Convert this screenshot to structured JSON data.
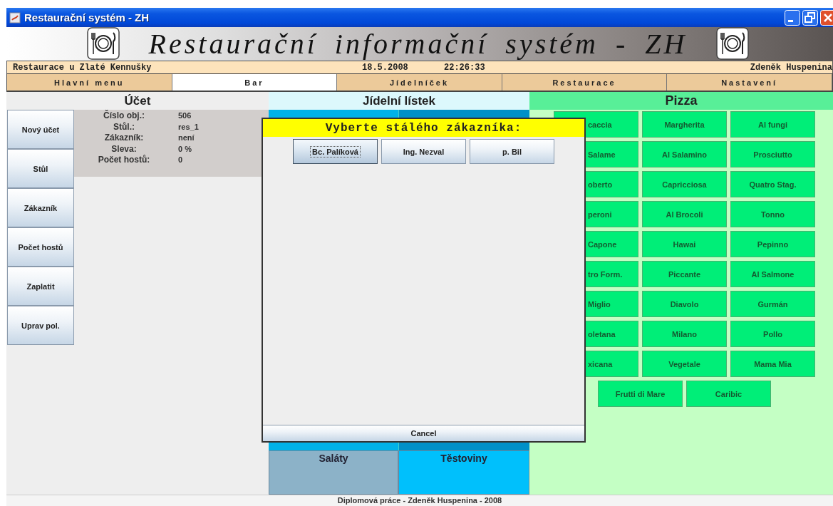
{
  "window": {
    "title": "Restaurační systém - ZH"
  },
  "banner": {
    "title": "Restaurační informační systém - ZH"
  },
  "info_bar": {
    "restaurant": "Restaurace u Zlaté Kennušky",
    "date": "18.5.2008",
    "time": "22:26:33",
    "user": "Zdeněk Huspenina"
  },
  "tabs": [
    {
      "label": "Hlavní menu",
      "selected": false
    },
    {
      "label": "Bar",
      "selected": true
    },
    {
      "label": "Jídelníček",
      "selected": false
    },
    {
      "label": "Restaurace",
      "selected": false
    },
    {
      "label": "Nastavení",
      "selected": false
    }
  ],
  "account": {
    "title": "Účet",
    "buttons": [
      "Nový účet",
      "Stůl",
      "Zákazník",
      "Počet hostů",
      "Zaplatit",
      "Uprav pol."
    ],
    "details": [
      {
        "label": "Číslo obj.:",
        "value": "506"
      },
      {
        "label": "Stůl.:",
        "value": "res_1"
      },
      {
        "label": "Zákazník:",
        "value": "není"
      },
      {
        "label": "Sleva:",
        "value": "0 %"
      },
      {
        "label": "Počet hostů:",
        "value": "0"
      }
    ]
  },
  "menu": {
    "title": "Jídelní lístek",
    "categories": [
      {
        "label": "Saláty",
        "color": "#8cb2c8"
      },
      {
        "label": "Těstoviny",
        "color": "#00c0fc"
      }
    ]
  },
  "pizza": {
    "title": "Pizza",
    "items": [
      "caccia",
      "Margherita",
      "Al fungi",
      "Salame",
      "Al Salamino",
      "Prosciutto",
      "oberto",
      "Capricciosa",
      "Quatro Stag.",
      "peroni",
      "Al Brocoli",
      "Tonno",
      "Capone",
      "Hawai",
      "Pepinno",
      "tro Form.",
      "Piccante",
      "Al Salmone",
      "Miglio",
      "Diavolo",
      "Gurmán",
      "oletana",
      "Milano",
      "Pollo",
      "xicana",
      "Vegetale",
      "Mama Mia",
      "Frutti di Mare",
      "Caribic"
    ]
  },
  "dialog": {
    "title": "Vyberte stálého zákazníka:",
    "customers": [
      {
        "label": "Bc. Palíková",
        "focused": true
      },
      {
        "label": "Ing. Nezval",
        "focused": false
      },
      {
        "label": "p. Bil",
        "focused": false
      }
    ],
    "cancel": "Cancel"
  },
  "footer": "Diplomová práce - Zdeněk Huspenina - 2008"
}
